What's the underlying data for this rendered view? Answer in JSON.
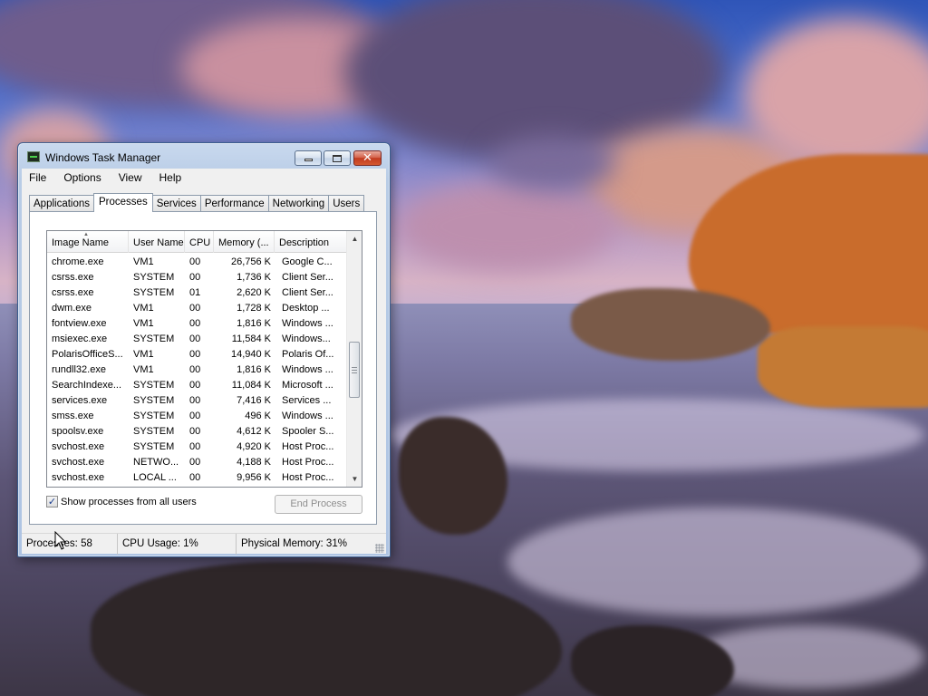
{
  "window": {
    "title": "Windows Task Manager",
    "controls": {
      "minimize": "minimize",
      "maximize": "maximize",
      "close": "✕"
    }
  },
  "menu": [
    "File",
    "Options",
    "View",
    "Help"
  ],
  "tabs": [
    "Applications",
    "Processes",
    "Services",
    "Performance",
    "Networking",
    "Users"
  ],
  "active_tab": "Processes",
  "processes": {
    "columns": [
      "Image Name",
      "User Name",
      "CPU",
      "Memory (...",
      "Description"
    ],
    "sort_indicator": "▲",
    "rows": [
      [
        "chrome.exe",
        "VM1",
        "00",
        "26,756 K",
        "Google C..."
      ],
      [
        "csrss.exe",
        "SYSTEM",
        "00",
        "1,736 K",
        "Client Ser..."
      ],
      [
        "csrss.exe",
        "SYSTEM",
        "01",
        "2,620 K",
        "Client Ser..."
      ],
      [
        "dwm.exe",
        "VM1",
        "00",
        "1,728 K",
        "Desktop ..."
      ],
      [
        "fontview.exe",
        "VM1",
        "00",
        "1,816 K",
        "Windows ..."
      ],
      [
        "msiexec.exe",
        "SYSTEM",
        "00",
        "11,584 K",
        "Windows..."
      ],
      [
        "PolarisOfficeS...",
        "VM1",
        "00",
        "14,940 K",
        "Polaris Of..."
      ],
      [
        "rundll32.exe",
        "VM1",
        "00",
        "1,816 K",
        "Windows ..."
      ],
      [
        "SearchIndexe...",
        "SYSTEM",
        "00",
        "11,084 K",
        "Microsoft ..."
      ],
      [
        "services.exe",
        "SYSTEM",
        "00",
        "7,416 K",
        "Services ..."
      ],
      [
        "smss.exe",
        "SYSTEM",
        "00",
        "496 K",
        "Windows ..."
      ],
      [
        "spoolsv.exe",
        "SYSTEM",
        "00",
        "4,612 K",
        "Spooler S..."
      ],
      [
        "svchost.exe",
        "SYSTEM",
        "00",
        "4,920 K",
        "Host Proc..."
      ],
      [
        "svchost.exe",
        "NETWO...",
        "00",
        "4,188 K",
        "Host Proc..."
      ],
      [
        "svchost.exe",
        "LOCAL ...",
        "00",
        "9,956 K",
        "Host Proc..."
      ]
    ],
    "scroll_up": "▲",
    "scroll_down": "▼"
  },
  "show_all": {
    "label": "Show processes from all users",
    "checked": "✓"
  },
  "end_process_label": "End Process",
  "status": {
    "processes": "Processes: 58",
    "cpu": "CPU Usage: 1%",
    "memory": "Physical Memory: 31%"
  },
  "colors": {
    "title_bar": "#b8cce6",
    "close_button": "#c23b20",
    "client_background": "#f0f0f0",
    "disabled_text": "#8e8e8e"
  }
}
